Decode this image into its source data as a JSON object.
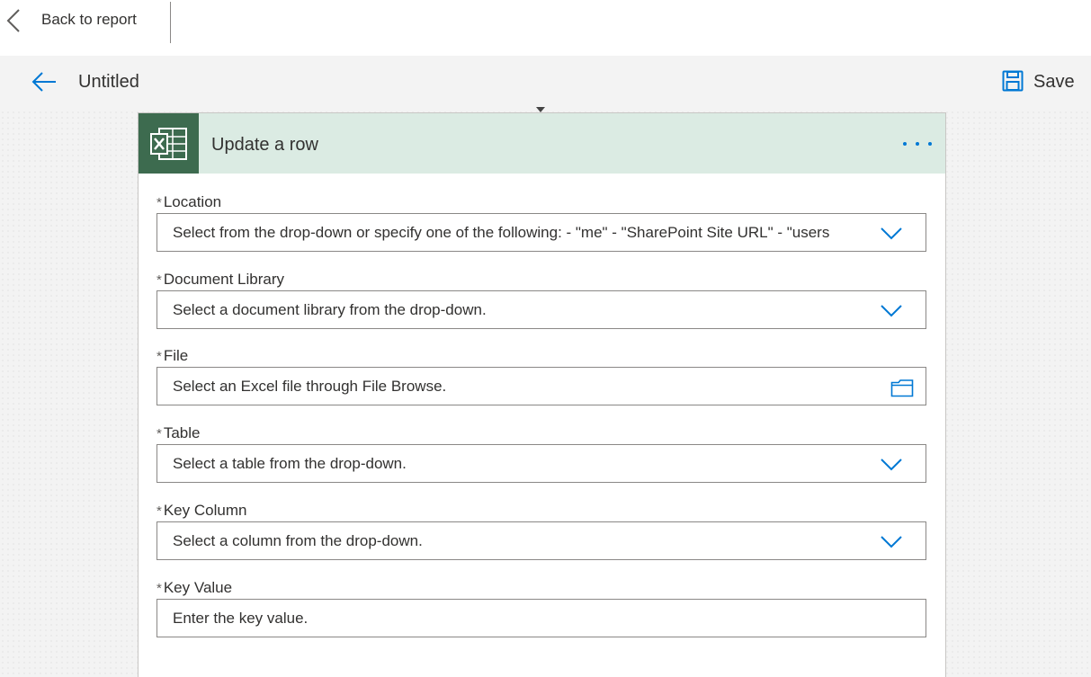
{
  "topbar": {
    "back_label": "Back to report"
  },
  "header": {
    "flow_title": "Untitled",
    "save_label": "Save"
  },
  "card": {
    "title": "Update a row",
    "icon": "excel-icon",
    "accent_color": "#3d6b4f",
    "header_bg": "#dbebe3",
    "fields": [
      {
        "label": "Location",
        "required": "*",
        "placeholder": "Select from the drop-down or specify one of the following: - \"me\" - \"SharePoint Site URL\" - \"users",
        "control": "dropdown"
      },
      {
        "label": "Document Library",
        "required": "*",
        "placeholder": "Select a document library from the drop-down.",
        "control": "dropdown"
      },
      {
        "label": "File",
        "required": "*",
        "placeholder": "Select an Excel file through File Browse.",
        "control": "file-browse"
      },
      {
        "label": "Table",
        "required": "*",
        "placeholder": "Select a table from the drop-down.",
        "control": "dropdown"
      },
      {
        "label": "Key Column",
        "required": "*",
        "placeholder": "Select a column from the drop-down.",
        "control": "dropdown"
      },
      {
        "label": "Key Value",
        "required": "*",
        "placeholder": "Enter the key value.",
        "control": "text"
      }
    ]
  },
  "colors": {
    "link_blue": "#0078d4"
  }
}
